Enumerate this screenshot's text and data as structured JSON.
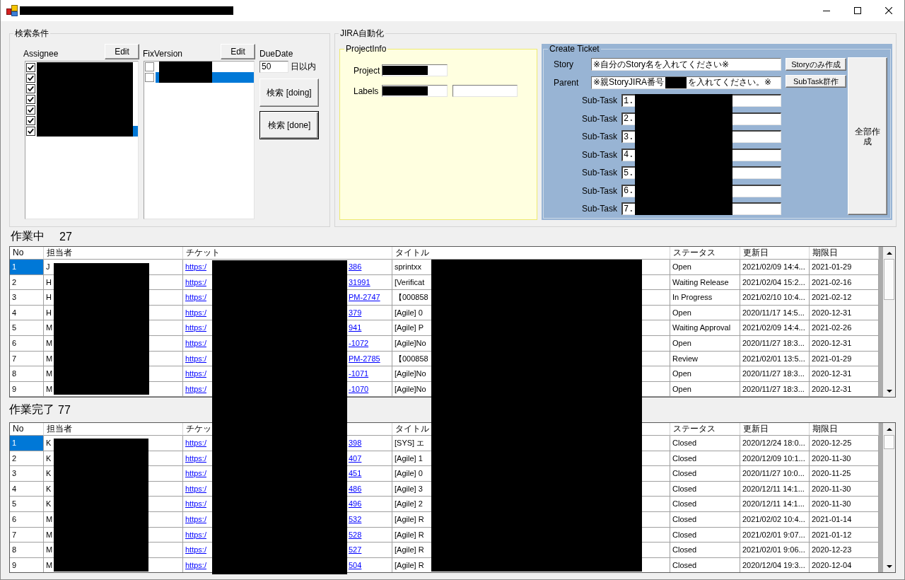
{
  "search_conditions": {
    "title": "検索条件",
    "assignee": {
      "label": "Assignee",
      "edit_button": "Edit",
      "items": [
        {
          "checked": true,
          "selected": false
        },
        {
          "checked": true,
          "selected": false
        },
        {
          "checked": true,
          "selected": false
        },
        {
          "checked": true,
          "selected": false
        },
        {
          "checked": true,
          "selected": false
        },
        {
          "checked": true,
          "selected": false
        },
        {
          "checked": true,
          "selected": true
        }
      ]
    },
    "fix_version": {
      "label": "FixVersion",
      "edit_button": "Edit",
      "items": [
        {
          "checked": false,
          "selected": false
        },
        {
          "checked": false,
          "selected": true
        }
      ]
    },
    "due_date": {
      "label": "DueDate",
      "value": "50",
      "unit": "日以内"
    },
    "search_buttons": [
      {
        "label": "検索 [doing]",
        "default": false
      },
      {
        "label": "検索 [done]",
        "default": true
      }
    ]
  },
  "jira_automation": {
    "title": "JIRA自動化",
    "project_info": {
      "title": "ProjectInfo",
      "fields": [
        {
          "label": "Project",
          "inputs": [
            {
              "redacted": true
            }
          ]
        },
        {
          "label": "Labels",
          "inputs": [
            {
              "redacted": true
            },
            {
              "redacted": false
            }
          ]
        }
      ]
    },
    "create_ticket": {
      "title": "Create Ticket",
      "story": {
        "label": "Story",
        "value_parts": [
          "※自分のStory名を入れてください※"
        ],
        "button": "Storyのみ作成"
      },
      "parent": {
        "label": "Parent",
        "value_parts": [
          "※親StoryJIRA番号",
          "を入れてください。※"
        ],
        "button": "SubTask群作"
      },
      "subtasks": [
        {
          "label": "Sub-Task",
          "value": "1."
        },
        {
          "label": "Sub-Task",
          "value": "2."
        },
        {
          "label": "Sub-Task",
          "value": "3."
        },
        {
          "label": "Sub-Task",
          "value": "4."
        },
        {
          "label": "Sub-Task",
          "value": "5."
        },
        {
          "label": "Sub-Task",
          "value": "6."
        },
        {
          "label": "Sub-Task",
          "value": "7."
        }
      ],
      "create_all_button": "全部作成"
    }
  },
  "in_progress": {
    "title": "作業中",
    "count": "27",
    "table": {
      "columns": [
        "No",
        "担当者",
        "チケット",
        "タイトル",
        "ステータス",
        "更新日",
        "期限日"
      ],
      "rows": [
        {
          "no": "1",
          "assignee": "J",
          "ticket": {
            "head": "https:/",
            "tail": "386"
          },
          "title": "sprintxx",
          "status": "Open",
          "updated": "2021/02/09 14:4...",
          "due": "2021-01-29",
          "selected": true
        },
        {
          "no": "2",
          "assignee": "H",
          "ticket": {
            "head": "https:/",
            "tail": "31991"
          },
          "title": "[Verificat",
          "status": "Waiting Release",
          "updated": "2021/02/04 15:2...",
          "due": "2021-02-16",
          "selected": false
        },
        {
          "no": "3",
          "assignee": "H",
          "ticket": {
            "head": "https:/",
            "tail": "PM-2747"
          },
          "title": "【000858",
          "status": "In Progress",
          "updated": "2021/02/10 10:4...",
          "due": "2021-02-12",
          "selected": false
        },
        {
          "no": "4",
          "assignee": "H",
          "ticket": {
            "head": "https:/",
            "tail": "379"
          },
          "title": "[Agile] 0",
          "status": "Open",
          "updated": "2020/11/17 14:5...",
          "due": "2020-12-31",
          "selected": false
        },
        {
          "no": "5",
          "assignee": "M",
          "ticket": {
            "head": "https:/",
            "tail": "941"
          },
          "title": "[Agile] P",
          "status": "Waiting Approval",
          "updated": "2021/02/09 14:4...",
          "due": "2021-02-26",
          "selected": false
        },
        {
          "no": "6",
          "assignee": "M",
          "ticket": {
            "head": "https:/",
            "tail": "-1072"
          },
          "title": "[Agile]No",
          "status": "Open",
          "updated": "2020/11/27 18:3...",
          "due": "2020-12-31",
          "selected": false
        },
        {
          "no": "7",
          "assignee": "M",
          "ticket": {
            "head": "https:/",
            "tail": "PM-2785"
          },
          "title": "【000858",
          "status": "Review",
          "updated": "2021/02/01 13:5...",
          "due": "2021-01-29",
          "selected": false
        },
        {
          "no": "8",
          "assignee": "M",
          "ticket": {
            "head": "https:/",
            "tail": "-1071"
          },
          "title": "[Agile]No",
          "status": "Open",
          "updated": "2020/11/27 18:3...",
          "due": "2020-12-31",
          "selected": false
        },
        {
          "no": "9",
          "assignee": "M",
          "ticket": {
            "head": "https:/",
            "tail": "-1070"
          },
          "title": "[Agile]No",
          "status": "Open",
          "updated": "2020/11/27 18:3...",
          "due": "2020-12-31",
          "selected": false
        }
      ]
    }
  },
  "done": {
    "title": "作業完了",
    "count": "77",
    "table": {
      "columns": [
        "No",
        "担当者",
        "チケッ",
        "タイトル",
        "ステータス",
        "更新日",
        "期限日"
      ],
      "rows": [
        {
          "no": "1",
          "assignee": "K",
          "ticket": {
            "head": "https:/",
            "tail": "398"
          },
          "title": "[SYS] エ",
          "status": "Closed",
          "updated": "2020/12/24 18:0...",
          "due": "2020-12-25",
          "selected": true
        },
        {
          "no": "2",
          "assignee": "K",
          "ticket": {
            "head": "https:/",
            "tail": "407"
          },
          "title": "[Agile] 1",
          "status": "Closed",
          "updated": "2020/12/09 10:1...",
          "due": "2020-11-30",
          "selected": false
        },
        {
          "no": "3",
          "assignee": "K",
          "ticket": {
            "head": "https:/",
            "tail": "451"
          },
          "title": "[Agile] 0",
          "status": "Closed",
          "updated": "2020/11/27 10:0...",
          "due": "2020-11-25",
          "selected": false
        },
        {
          "no": "4",
          "assignee": "K",
          "ticket": {
            "head": "https:/",
            "tail": "486"
          },
          "title": "[Agile] 3",
          "status": "Closed",
          "updated": "2020/12/11 14:1...",
          "due": "2020-11-30",
          "selected": false
        },
        {
          "no": "5",
          "assignee": "K",
          "ticket": {
            "head": "https:/",
            "tail": "496"
          },
          "title": "[Agile] 2",
          "status": "Closed",
          "updated": "2020/12/11 14:1...",
          "due": "2020-11-30",
          "selected": false
        },
        {
          "no": "6",
          "assignee": "M",
          "ticket": {
            "head": "https:/",
            "tail": "532"
          },
          "title": "[Agile] R",
          "status": "Closed",
          "updated": "2021/02/02 10:4...",
          "due": "2021-01-14",
          "selected": false
        },
        {
          "no": "7",
          "assignee": "M",
          "ticket": {
            "head": "https:/",
            "tail": "528"
          },
          "title": "[Agile] R",
          "status": "Closed",
          "updated": "2021/02/01 9:07...",
          "due": "2021-01-12",
          "selected": false
        },
        {
          "no": "8",
          "assignee": "M",
          "ticket": {
            "head": "https:/",
            "tail": "527"
          },
          "title": "[Agile] R",
          "status": "Closed",
          "updated": "2021/02/01 9:06...",
          "due": "2020-12-23",
          "selected": false
        },
        {
          "no": "9",
          "assignee": "M",
          "ticket": {
            "head": "https:/",
            "tail": "504"
          },
          "title": "[Agile] R",
          "status": "Closed",
          "updated": "2020/12/04 19:3...",
          "due": "2020-12-04",
          "selected": false
        }
      ]
    }
  }
}
